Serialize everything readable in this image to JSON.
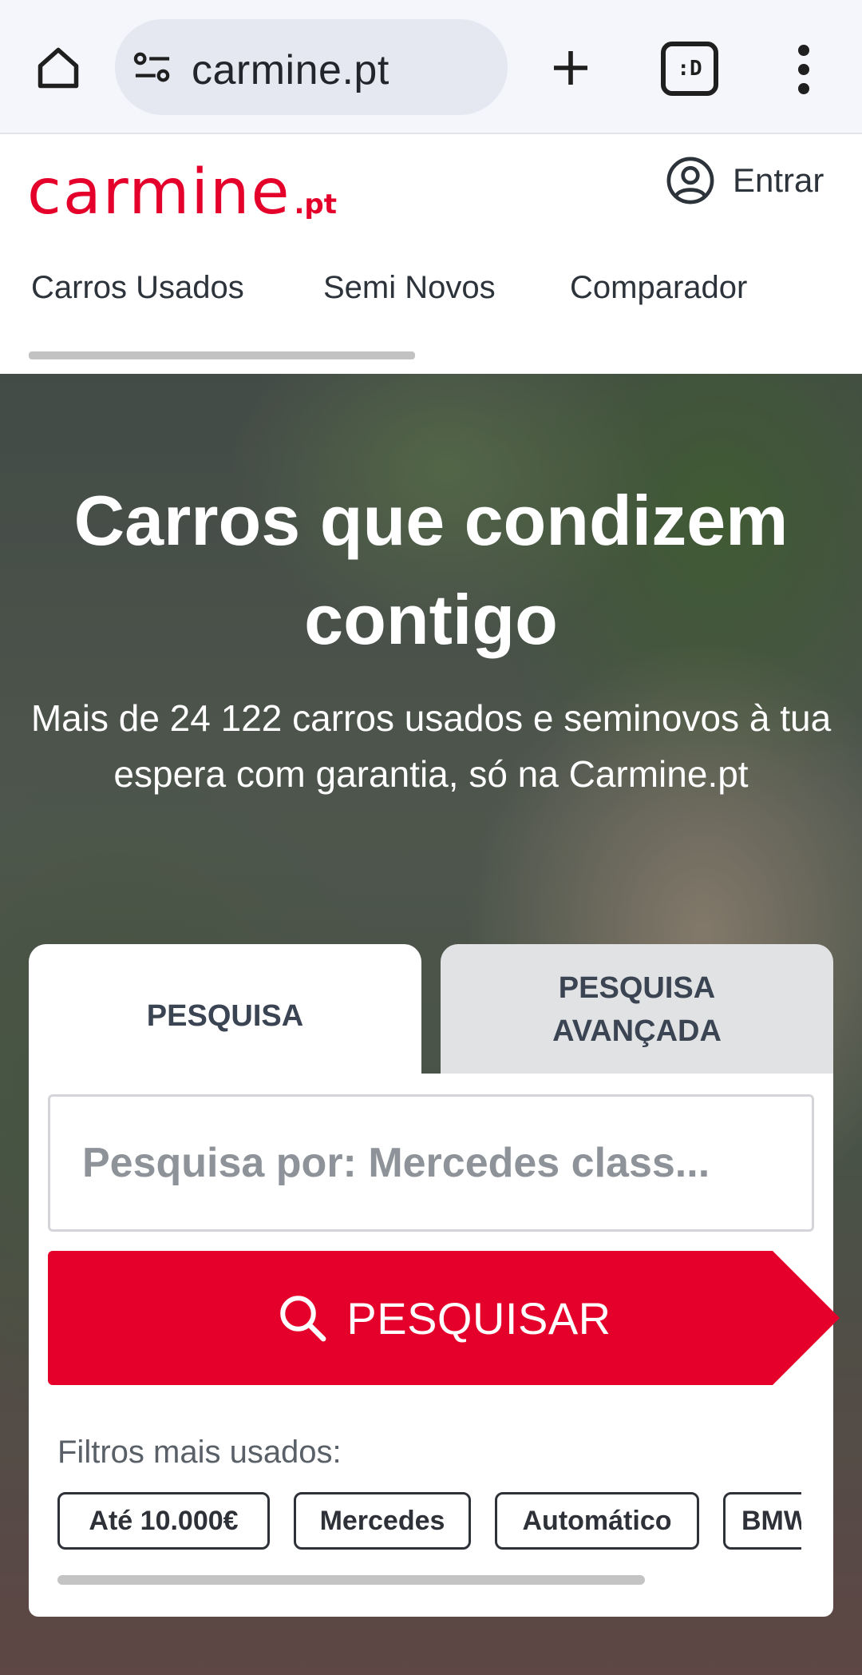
{
  "browser": {
    "url": "carmine.pt",
    "tabs_icon_text": ":D"
  },
  "header": {
    "logo_main": "carmine",
    "logo_suffix": ".pt",
    "login_label": "Entrar"
  },
  "nav": {
    "items": [
      {
        "label": "Carros Usados"
      },
      {
        "label": "Semi Novos"
      },
      {
        "label": "Comparador"
      }
    ]
  },
  "hero": {
    "title": "Carros que condizem contigo",
    "subtitle": "Mais de 24 122 carros usados e seminovos à tua espera com garantia, só na Carmine.pt"
  },
  "search": {
    "tab_basic": "PESQUISA",
    "tab_advanced": "PESQUISA AVANÇADA",
    "placeholder": "Pesquisa por: Mercedes class...",
    "button_label": "PESQUISAR",
    "filters_title": "Filtros mais usados:",
    "chips": [
      {
        "label": "Até 10.000€"
      },
      {
        "label": "Mercedes"
      },
      {
        "label": "Automático"
      },
      {
        "label": "BMW"
      }
    ]
  },
  "colors": {
    "brand": "#e4002b",
    "text": "#2d333a"
  }
}
